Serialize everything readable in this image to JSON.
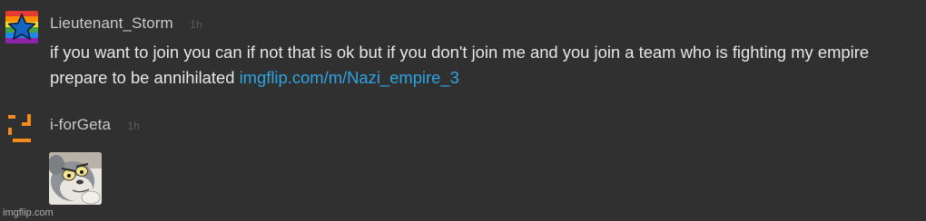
{
  "comments": [
    {
      "username": "Lieutenant_Storm",
      "timestamp": "1h",
      "text": "if you want to join you can if not that is ok but if you don't join me and you join a team who is fighting my empire prepare to be annihilated ",
      "link_text": "imgflip.com/m/Nazi_empire_3",
      "avatar_icon": "rainbow-star-icon"
    },
    {
      "username": "i-forGeta",
      "timestamp": "1h",
      "avatar_icon": "orange-bracket-icon",
      "image_icon": "tom-cat-meme-thumbnail"
    }
  ],
  "watermark": "imgflip.com",
  "colors": {
    "background": "#303030",
    "username": "#c9c9c9",
    "timestamp": "#5d5d5d",
    "text": "#e6e6e6",
    "link": "#2ea4e3",
    "orange_avatar": "#f28a1e"
  }
}
